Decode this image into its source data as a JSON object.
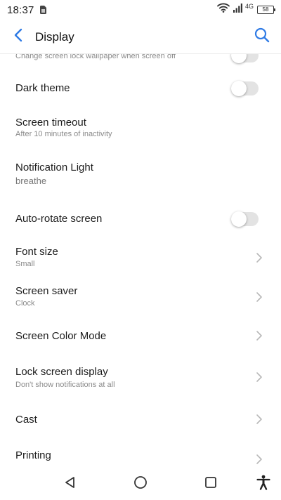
{
  "status_bar": {
    "time": "18:37",
    "network_type": "4G",
    "battery_level": "58"
  },
  "header": {
    "title": "Display"
  },
  "settings": {
    "lock_wallpaper": {
      "subtitle": "Change screen lock wallpaper when screen off",
      "enabled": false
    },
    "dark_theme": {
      "title": "Dark theme",
      "enabled": false
    },
    "screen_timeout": {
      "title": "Screen timeout",
      "subtitle": "After 10 minutes of inactivity"
    },
    "notification_light": {
      "title": "Notification Light",
      "subtitle": "breathe"
    },
    "auto_rotate": {
      "title": "Auto-rotate screen",
      "enabled": false
    },
    "font_size": {
      "title": "Font size",
      "subtitle": "Small"
    },
    "screen_saver": {
      "title": "Screen saver",
      "subtitle": "Clock"
    },
    "screen_color_mode": {
      "title": "Screen Color Mode"
    },
    "lock_screen_display": {
      "title": "Lock screen display",
      "subtitle": "Don't show notifications at all"
    },
    "cast": {
      "title": "Cast"
    },
    "printing": {
      "title": "Printing"
    }
  },
  "colors": {
    "accent": "#2f7be5",
    "toggle_off_track": "#e3e3e3",
    "subtitle": "#8a8a8a"
  },
  "icons": {
    "back": "chevron-left-icon",
    "search": "search-icon",
    "nav_back": "triangle-back-icon",
    "nav_home": "circle-home-icon",
    "nav_recents": "square-recents-icon",
    "accessibility": "accessibility-icon"
  }
}
